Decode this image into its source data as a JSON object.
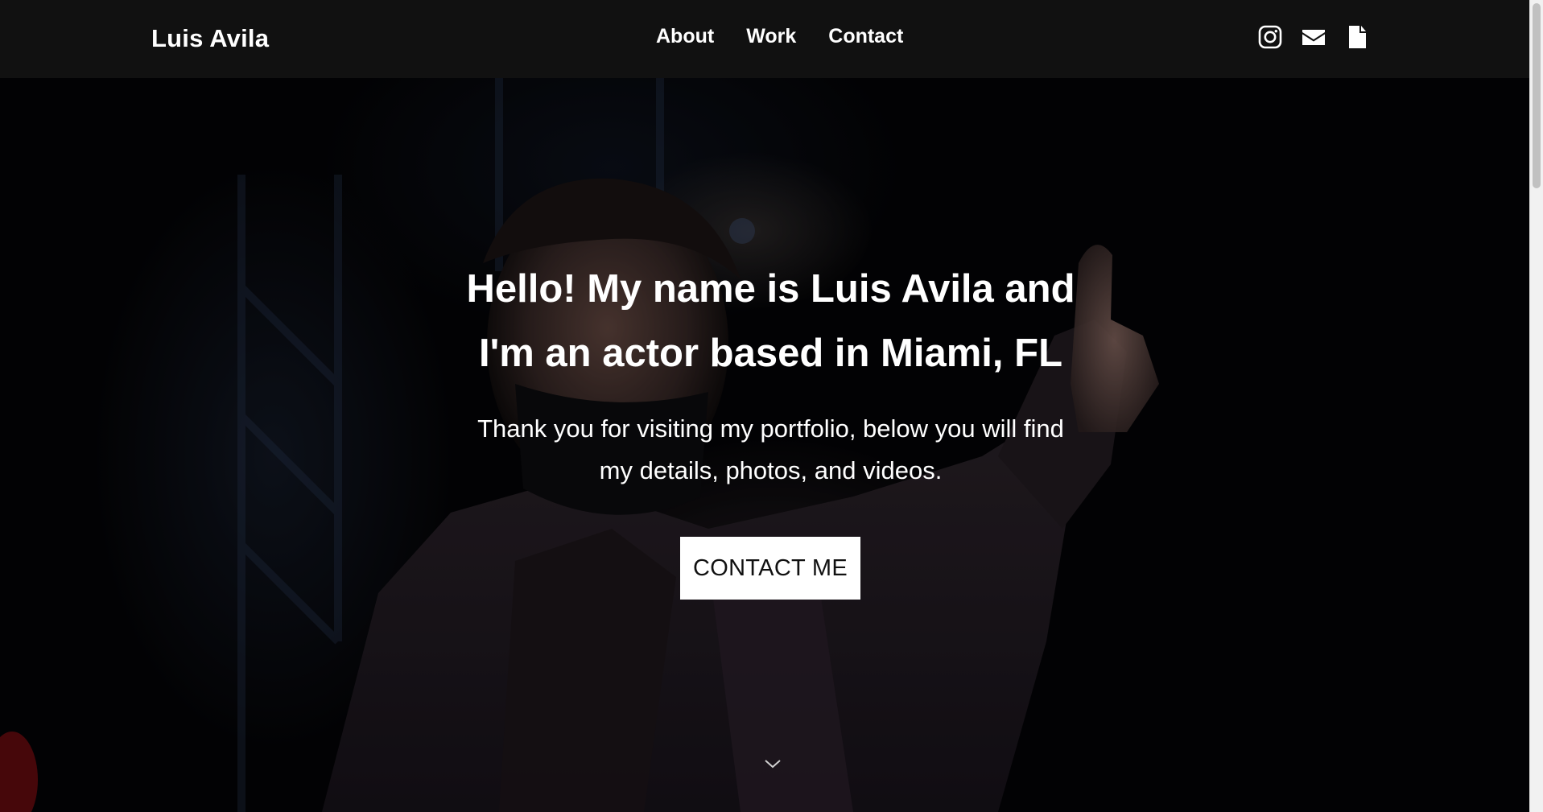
{
  "navbar": {
    "brand": "Luis Avila",
    "links": [
      "About",
      "Work",
      "Contact"
    ],
    "icons": [
      "instagram-icon",
      "envelope-icon",
      "document-icon"
    ]
  },
  "hero": {
    "title_line1": "Hello! My name is Luis Avila and",
    "title_line2": "I'm an actor based in Miami, FL",
    "subtitle_line1": "Thank you for visiting my portfolio, below you will find",
    "subtitle_line2": "my details, photos, and videos.",
    "cta_label": "CONTACT ME",
    "scroll_icon": "chevron-down-icon"
  },
  "colors": {
    "navbar_bg": "#111111",
    "text": "#ffffff",
    "button_bg": "#ffffff",
    "button_text": "#111111"
  }
}
